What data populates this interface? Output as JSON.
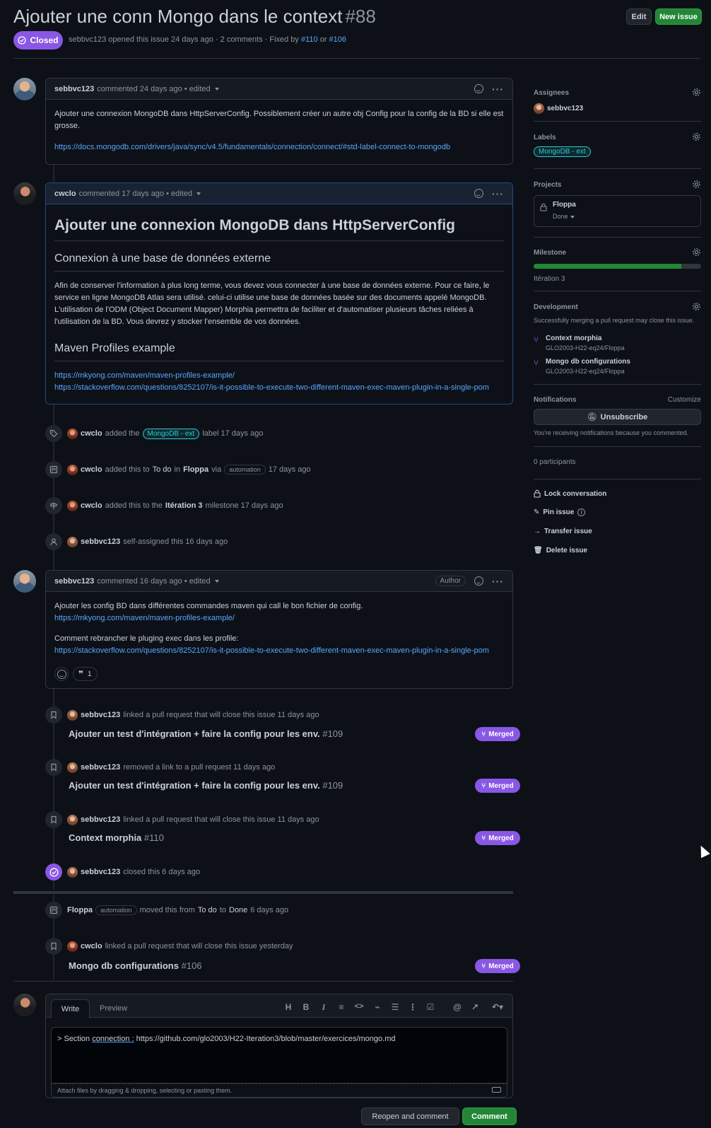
{
  "issue": {
    "title": "Ajouter une conn Mongo dans le context",
    "number": "#88",
    "state": "Closed",
    "author": "sebbvc123",
    "opened_text": "opened this issue 24 days ago · 2 comments · Fixed by",
    "fixed_by_1": "#110",
    "or_text": "or",
    "fixed_by_2": "#106"
  },
  "header_buttons": {
    "edit": "Edit",
    "new_issue": "New issue"
  },
  "comments": [
    {
      "author": "sebbvc123",
      "meta": "commented 24 days ago • edited",
      "body_1": "Ajouter une connexion MongoDB dans HttpServerConfig. Possiblement créer un autre obj Config pour la config de la BD si elle est grosse.",
      "link": "https://docs.mongodb.com/drivers/java/sync/v4.5/fundamentals/connection/connect/#std-label-connect-to-mongodb"
    },
    {
      "author": "cwclo",
      "meta": "commented 17 days ago • edited",
      "h1": "Ajouter une connexion MongoDB dans HttpServerConfig",
      "h2_a": "Connexion à une base de données externe",
      "para": "Afin de conserver l'information à plus long terme, vous devez vous connecter à une base de données externe. Pour ce faire, le service en ligne MongoDB Atlas sera utilisé. celui-ci utilise une base de données basée sur des documents appelé MongoDB. L'utilisation de l'ODM (Object Document Mapper) Morphia permettra de faciliter et d'automatiser plusieurs tâches reliées à l'utilisation de la BD. Vous devrez y stocker l'ensemble de vos données.",
      "h2_b": "Maven Profiles example",
      "link_1": "https://mkyong.com/maven/maven-profiles-example/",
      "link_2": "https://stackoverflow.com/questions/8252107/is-it-possible-to-execute-two-different-maven-exec-maven-plugin-in-a-single-pom"
    },
    {
      "author": "sebbvc123",
      "meta": "commented 16 days ago • edited",
      "badge": "Author",
      "line_1": "Ajouter les config BD dans différentes commandes maven qui call le bon fichier de config.",
      "link_1": "https://mkyong.com/maven/maven-profiles-example/",
      "line_2": "Comment rebrancher le pluging exec dans les profile:",
      "link_2": "https://stackoverflow.com/questions/8252107/is-it-possible-to-execute-two-different-maven-exec-maven-plugin-in-a-single-pom",
      "reaction_count": "1"
    }
  ],
  "timeline": {
    "label_event": {
      "actor": "cwclo",
      "pre": "added the",
      "label": "MongoDB - ext",
      "post": "label 17 days ago"
    },
    "project_event": {
      "actor": "cwclo",
      "pre": "added this to",
      "column": "To do",
      "in": "in",
      "project": "Floppa",
      "via": "via",
      "pill": "automation",
      "post": "17 days ago"
    },
    "milestone_event": {
      "actor": "cwclo",
      "pre": "added this to the",
      "milestone": "Itération 3",
      "post": "milestone 17 days ago"
    },
    "assign_event": {
      "actor": "sebbvc123",
      "text": "self-assigned this 16 days ago"
    },
    "link_1": {
      "actor": "sebbvc123",
      "text": "linked a pull request that will close this issue 11 days ago",
      "pr_title": "Ajouter un test d'intégration + faire la config pour les env.",
      "pr_num": "#109",
      "status": "Merged"
    },
    "unlink": {
      "actor": "sebbvc123",
      "text": "removed a link to a pull request 11 days ago",
      "pr_title": "Ajouter un test d'intégration + faire la config pour les env.",
      "pr_num": "#109",
      "status": "Merged"
    },
    "link_2": {
      "actor": "sebbvc123",
      "text": "linked a pull request that will close this issue 11 days ago",
      "pr_title": "Context morphia",
      "pr_num": "#110",
      "status": "Merged"
    },
    "closed": {
      "actor": "sebbvc123",
      "text": "closed this 6 days ago"
    },
    "moved": {
      "actor": "Floppa",
      "pill": "automation",
      "pre": "moved this from",
      "from": "To do",
      "to_word": "to",
      "to": "Done",
      "post": "6 days ago"
    },
    "link_3": {
      "actor": "cwclo",
      "text": "linked a pull request that will close this issue yesterday",
      "pr_title": "Mongo db configurations",
      "pr_num": "#106",
      "status": "Merged"
    }
  },
  "sidebar": {
    "assignees_title": "Assignees",
    "assignee": "sebbvc123",
    "labels_title": "Labels",
    "label": "MongoDB - ext",
    "projects_title": "Projects",
    "project_name": "Floppa",
    "project_status": "Done",
    "milestone_title": "Milestone",
    "milestone_progress": 0.88,
    "milestone_name": "Itération 3",
    "development_title": "Development",
    "development_note": "Successfully merging a pull request may close this issue.",
    "dev_items": [
      {
        "title": "Context morphia",
        "repo": "GLO2003-H22-eq24/Floppa"
      },
      {
        "title": "Mongo db configurations",
        "repo": "GLO2003-H22-eq24/Floppa"
      }
    ],
    "notifications_title": "Notifications",
    "customize": "Customize",
    "unsubscribe": "Unsubscribe",
    "notif_reason": "You're receiving notifications because you commented.",
    "participants": "0 participants",
    "lock": "Lock conversation",
    "pin": "Pin issue",
    "transfer": "Transfer issue",
    "delete": "Delete issue"
  },
  "composer": {
    "tab_write": "Write",
    "tab_preview": "Preview",
    "text_pre": "> Section",
    "text_link": "connection :",
    "text_post": "https://github.com/glo2003/H22-Iteration3/blob/master/exercices/mongo.md",
    "attach_hint": "Attach files by dragging & dropping, selecting or pasting them.",
    "reopen": "Reopen and comment",
    "comment": "Comment"
  },
  "colors": {
    "accent": "#58a6ff",
    "closed_purple": "#8957e5",
    "green": "#238636",
    "label_cyan": "#39c5cf"
  }
}
